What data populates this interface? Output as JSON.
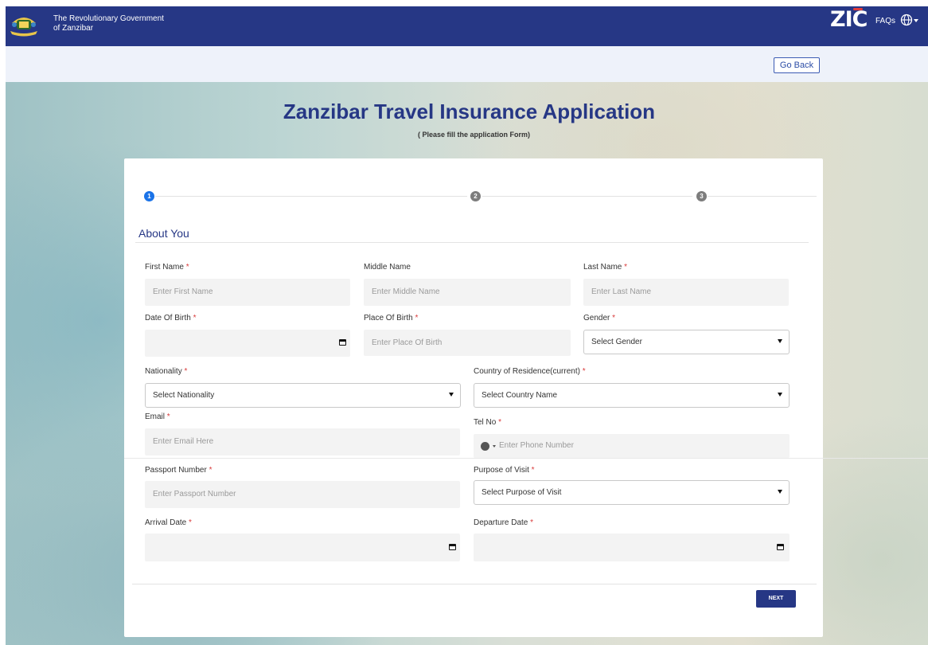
{
  "header": {
    "gov_name": "The Revolutionary Government\nof Zanzibar",
    "brand_logo_text": "ZIC",
    "faqs_label": "FAQs",
    "language_icon": "globe-icon",
    "colors": {
      "nav_bg": "#263785",
      "accent": "#1a73e8",
      "required": "#d93b3b"
    }
  },
  "subbar": {
    "go_back_label": "Go Back"
  },
  "page": {
    "title": "Zanzibar Travel Insurance Application",
    "subtitle": "( Please fill the application Form)"
  },
  "stepper": {
    "steps": [
      "1",
      "2",
      "3"
    ],
    "active_step": 1
  },
  "form": {
    "section_title": "About You",
    "required_marker": "*",
    "fields": {
      "first_name": {
        "label": "First Name",
        "placeholder": "Enter First Name"
      },
      "middle_name": {
        "label": "Middle Name",
        "placeholder": "Enter Middle Name"
      },
      "last_name": {
        "label": "Last Name",
        "placeholder": "Enter Last Name"
      },
      "date_of_birth": {
        "label": "Date Of Birth",
        "value": ""
      },
      "place_of_birth": {
        "label": "Place Of Birth",
        "placeholder": "Enter Place Of Birth"
      },
      "gender": {
        "label": "Gender",
        "selected": "Select Gender"
      },
      "nationality": {
        "label": "Nationality",
        "selected": "Select Nationality"
      },
      "country_of_residence": {
        "label": "Country of Residence(current)",
        "selected": "Select Country Name"
      },
      "email": {
        "label": "Email",
        "placeholder": "Enter Email Here"
      },
      "tel_no": {
        "label": "Tel No",
        "placeholder": "Enter Phone Number"
      },
      "passport_number": {
        "label": "Passport Number",
        "placeholder": "Enter Passport Number"
      },
      "purpose_of_visit": {
        "label": "Purpose of Visit",
        "selected": "Select Purpose of Visit"
      },
      "arrival_date": {
        "label": "Arrival Date",
        "value": ""
      },
      "departure_date": {
        "label": "Departure Date",
        "value": ""
      }
    },
    "next_label": "NEXT"
  }
}
